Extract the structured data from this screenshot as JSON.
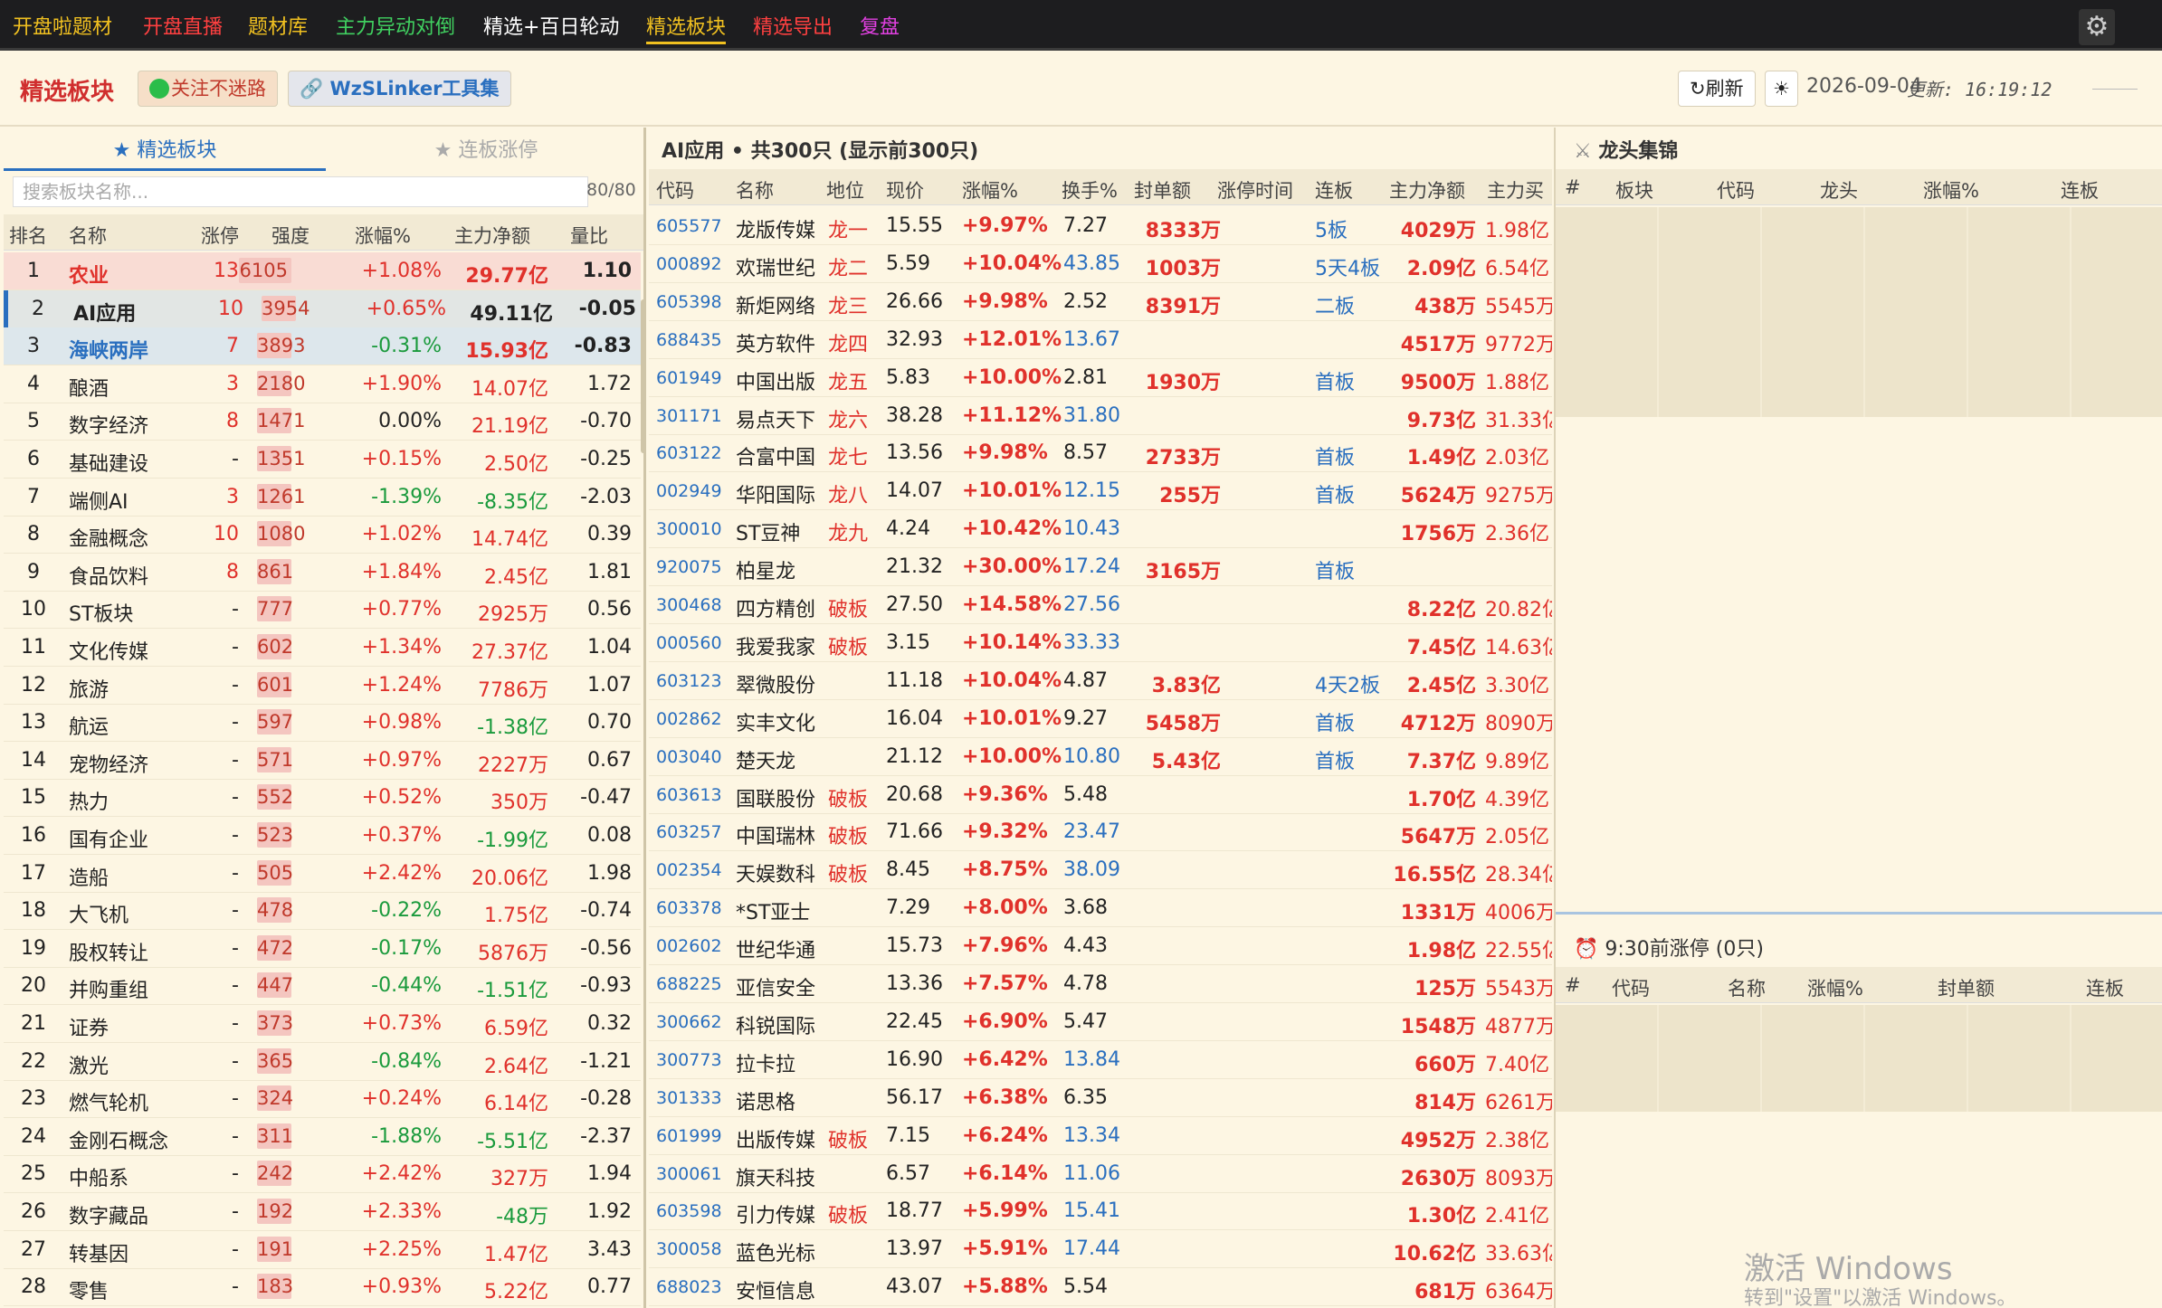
{
  "nav": {
    "items": [
      {
        "label": "开盘啦题材",
        "color": "#f0c020"
      },
      {
        "label": "开盘直播",
        "color": "#ff4040"
      },
      {
        "label": "题材库",
        "color": "#f0c020"
      },
      {
        "label": "主力异动对倒",
        "color": "#40d060"
      },
      {
        "label": "精选+百日轮动",
        "color": "#ffffff"
      },
      {
        "label": "精选板块",
        "color": "#f0c020"
      },
      {
        "label": "精选导出",
        "color": "#ff4040"
      },
      {
        "label": "复盘",
        "color": "#e040e0"
      }
    ],
    "settings_icon": "gear-icon"
  },
  "header": {
    "title": "精选板块",
    "follow_label": "关注不迷路",
    "tool_label": "WzSLinker工具集",
    "refresh_label": "刷新",
    "theme_icon": "sun-icon",
    "date": "2026-09-04",
    "update_text": "更新: 16:19:12"
  },
  "left": {
    "tabs": [
      "★ 精选板块",
      "★ 连板涨停"
    ],
    "search_placeholder": "搜索板块名称...",
    "count": "80/80",
    "columns": [
      "排名",
      "名称",
      "涨停",
      "强度",
      "涨幅%",
      "主力净额",
      "量比"
    ],
    "rows": [
      {
        "rank": "1",
        "name": "农业",
        "zt": "13",
        "strength": "6105",
        "strength_level": 1.0,
        "chg": "+1.08%",
        "net": "29.77亿",
        "vr": "1.10"
      },
      {
        "rank": "2",
        "name": "AI应用",
        "zt": "10",
        "strength": "3954",
        "strength_level": 0.65,
        "chg": "+0.65%",
        "net": "49.11亿",
        "vr": "-0.05"
      },
      {
        "rank": "3",
        "name": "海峡两岸",
        "zt": "7",
        "strength": "3893",
        "strength_level": 0.64,
        "chg": "-0.31%",
        "net": "15.93亿",
        "vr": "-0.83"
      },
      {
        "rank": "4",
        "name": "酿酒",
        "zt": "3",
        "strength": "2180",
        "strength_level": 0.36,
        "chg": "+1.90%",
        "net": "14.07亿",
        "vr": "1.72"
      },
      {
        "rank": "5",
        "name": "数字经济",
        "zt": "8",
        "strength": "1471",
        "strength_level": 0.24,
        "chg": "0.00%",
        "net": "21.19亿",
        "vr": "-0.70"
      },
      {
        "rank": "6",
        "name": "基础建设",
        "zt": "-",
        "strength": "1351",
        "strength_level": 0.22,
        "chg": "+0.15%",
        "net": "2.50亿",
        "vr": "-0.25"
      },
      {
        "rank": "7",
        "name": "端侧AI",
        "zt": "3",
        "strength": "1261",
        "strength_level": 0.21,
        "chg": "-1.39%",
        "net": "-8.35亿",
        "vr": "-2.03"
      },
      {
        "rank": "8",
        "name": "金融概念",
        "zt": "10",
        "strength": "1080",
        "strength_level": 0.18,
        "chg": "+1.02%",
        "net": "14.74亿",
        "vr": "0.39"
      },
      {
        "rank": "9",
        "name": "食品饮料",
        "zt": "8",
        "strength": "861",
        "strength_level": 0.14,
        "chg": "+1.84%",
        "net": "2.45亿",
        "vr": "1.81"
      },
      {
        "rank": "10",
        "name": "ST板块",
        "zt": "-",
        "strength": "777",
        "strength_level": 0.13,
        "chg": "+0.77%",
        "net": "2925万",
        "vr": "0.56"
      },
      {
        "rank": "11",
        "name": "文化传媒",
        "zt": "-",
        "strength": "602",
        "strength_level": 0.1,
        "chg": "+1.34%",
        "net": "27.37亿",
        "vr": "1.04"
      },
      {
        "rank": "12",
        "name": "旅游",
        "zt": "-",
        "strength": "601",
        "strength_level": 0.1,
        "chg": "+1.24%",
        "net": "7786万",
        "vr": "1.07"
      },
      {
        "rank": "13",
        "name": "航运",
        "zt": "-",
        "strength": "597",
        "strength_level": 0.1,
        "chg": "+0.98%",
        "net": "-1.38亿",
        "vr": "0.70"
      },
      {
        "rank": "14",
        "name": "宠物经济",
        "zt": "-",
        "strength": "571",
        "strength_level": 0.09,
        "chg": "+0.97%",
        "net": "2227万",
        "vr": "0.67"
      },
      {
        "rank": "15",
        "name": "热力",
        "zt": "-",
        "strength": "552",
        "strength_level": 0.09,
        "chg": "+0.52%",
        "net": "350万",
        "vr": "-0.47"
      },
      {
        "rank": "16",
        "name": "国有企业",
        "zt": "-",
        "strength": "523",
        "strength_level": 0.09,
        "chg": "+0.37%",
        "net": "-1.99亿",
        "vr": "0.08"
      },
      {
        "rank": "17",
        "name": "造船",
        "zt": "-",
        "strength": "505",
        "strength_level": 0.08,
        "chg": "+2.42%",
        "net": "20.06亿",
        "vr": "1.98"
      },
      {
        "rank": "18",
        "name": "大飞机",
        "zt": "-",
        "strength": "478",
        "strength_level": 0.08,
        "chg": "-0.22%",
        "net": "1.75亿",
        "vr": "-0.74"
      },
      {
        "rank": "19",
        "name": "股权转让",
        "zt": "-",
        "strength": "472",
        "strength_level": 0.08,
        "chg": "-0.17%",
        "net": "5876万",
        "vr": "-0.56"
      },
      {
        "rank": "20",
        "name": "并购重组",
        "zt": "-",
        "strength": "447",
        "strength_level": 0.07,
        "chg": "-0.44%",
        "net": "-1.51亿",
        "vr": "-0.93"
      },
      {
        "rank": "21",
        "name": "证券",
        "zt": "-",
        "strength": "373",
        "strength_level": 0.06,
        "chg": "+0.73%",
        "net": "6.59亿",
        "vr": "0.32"
      },
      {
        "rank": "22",
        "name": "激光",
        "zt": "-",
        "strength": "365",
        "strength_level": 0.06,
        "chg": "-0.84%",
        "net": "2.64亿",
        "vr": "-1.21"
      },
      {
        "rank": "23",
        "name": "燃气轮机",
        "zt": "-",
        "strength": "324",
        "strength_level": 0.05,
        "chg": "+0.24%",
        "net": "6.14亿",
        "vr": "-0.28"
      },
      {
        "rank": "24",
        "name": "金刚石概念",
        "zt": "-",
        "strength": "311",
        "strength_level": 0.05,
        "chg": "-1.88%",
        "net": "-5.51亿",
        "vr": "-2.37"
      },
      {
        "rank": "25",
        "name": "中船系",
        "zt": "-",
        "strength": "242",
        "strength_level": 0.04,
        "chg": "+2.42%",
        "net": "327万",
        "vr": "1.94"
      },
      {
        "rank": "26",
        "name": "数字藏品",
        "zt": "-",
        "strength": "192",
        "strength_level": 0.03,
        "chg": "+2.33%",
        "net": "-48万",
        "vr": "1.92"
      },
      {
        "rank": "27",
        "name": "转基因",
        "zt": "-",
        "strength": "191",
        "strength_level": 0.03,
        "chg": "+2.25%",
        "net": "1.47亿",
        "vr": "3.43"
      },
      {
        "rank": "28",
        "name": "零售",
        "zt": "-",
        "strength": "183",
        "strength_level": 0.03,
        "chg": "+0.93%",
        "net": "5.22亿",
        "vr": "0.77"
      }
    ]
  },
  "mid": {
    "title": "AI应用 • 共300只 (显示前300只)",
    "columns": [
      "代码",
      "名称",
      "地位",
      "现价",
      "涨幅%",
      "换手%",
      "封单额",
      "涨停时间",
      "连板",
      "主力净额",
      "主力买"
    ],
    "rows": [
      {
        "code": "605577",
        "name": "龙版传媒",
        "pos": "龙一",
        "price": "15.55",
        "chg": "+9.97%",
        "turn": "7.27",
        "seal": "8333万",
        "time": "",
        "lb": "5板",
        "net": "4029万",
        "buy": "1.98亿"
      },
      {
        "code": "000892",
        "name": "欢瑞世纪",
        "pos": "龙二",
        "price": "5.59",
        "chg": "+10.04%",
        "turn": "43.85",
        "seal": "1003万",
        "time": "",
        "lb": "5天4板",
        "net": "2.09亿",
        "buy": "6.54亿"
      },
      {
        "code": "605398",
        "name": "新炬网络",
        "pos": "龙三",
        "price": "26.66",
        "chg": "+9.98%",
        "turn": "2.52",
        "seal": "8391万",
        "time": "",
        "lb": "二板",
        "net": "438万",
        "buy": "5545万"
      },
      {
        "code": "688435",
        "name": "英方软件",
        "pos": "龙四",
        "price": "32.93",
        "chg": "+12.01%",
        "turn": "13.67",
        "seal": "",
        "time": "",
        "lb": "",
        "net": "4517万",
        "buy": "9772万"
      },
      {
        "code": "601949",
        "name": "中国出版",
        "pos": "龙五",
        "price": "5.83",
        "chg": "+10.00%",
        "turn": "2.81",
        "seal": "1930万",
        "time": "",
        "lb": "首板",
        "net": "9500万",
        "buy": "1.88亿"
      },
      {
        "code": "301171",
        "name": "易点天下",
        "pos": "龙六",
        "price": "38.28",
        "chg": "+11.12%",
        "turn": "31.80",
        "seal": "",
        "time": "",
        "lb": "",
        "net": "9.73亿",
        "buy": "31.33亿"
      },
      {
        "code": "603122",
        "name": "合富中国",
        "pos": "龙七",
        "price": "13.56",
        "chg": "+9.98%",
        "turn": "8.57",
        "seal": "2733万",
        "time": "",
        "lb": "首板",
        "net": "1.49亿",
        "buy": "2.03亿"
      },
      {
        "code": "002949",
        "name": "华阳国际",
        "pos": "龙八",
        "price": "14.07",
        "chg": "+10.01%",
        "turn": "12.15",
        "seal": "255万",
        "time": "",
        "lb": "首板",
        "net": "5624万",
        "buy": "9275万"
      },
      {
        "code": "300010",
        "name": "ST豆神",
        "pos": "龙九",
        "price": "4.24",
        "chg": "+10.42%",
        "turn": "10.43",
        "seal": "",
        "time": "",
        "lb": "",
        "net": "1756万",
        "buy": "2.36亿"
      },
      {
        "code": "920075",
        "name": "柏星龙",
        "pos": "",
        "price": "21.32",
        "chg": "+30.00%",
        "turn": "17.24",
        "seal": "3165万",
        "time": "",
        "lb": "首板",
        "net": "",
        "buy": ""
      },
      {
        "code": "300468",
        "name": "四方精创",
        "pos": "破板",
        "price": "27.50",
        "chg": "+14.58%",
        "turn": "27.56",
        "seal": "",
        "time": "",
        "lb": "",
        "net": "8.22亿",
        "buy": "20.82亿"
      },
      {
        "code": "000560",
        "name": "我爱我家",
        "pos": "破板",
        "price": "3.15",
        "chg": "+10.14%",
        "turn": "33.33",
        "seal": "",
        "time": "",
        "lb": "",
        "net": "7.45亿",
        "buy": "14.63亿"
      },
      {
        "code": "603123",
        "name": "翠微股份",
        "pos": "",
        "price": "11.18",
        "chg": "+10.04%",
        "turn": "4.87",
        "seal": "3.83亿",
        "time": "",
        "lb": "4天2板",
        "net": "2.45亿",
        "buy": "3.30亿"
      },
      {
        "code": "002862",
        "name": "实丰文化",
        "pos": "",
        "price": "16.04",
        "chg": "+10.01%",
        "turn": "9.27",
        "seal": "5458万",
        "time": "",
        "lb": "首板",
        "net": "4712万",
        "buy": "8090万"
      },
      {
        "code": "003040",
        "name": "楚天龙",
        "pos": "",
        "price": "21.12",
        "chg": "+10.00%",
        "turn": "10.80",
        "seal": "5.43亿",
        "time": "",
        "lb": "首板",
        "net": "7.37亿",
        "buy": "9.89亿"
      },
      {
        "code": "603613",
        "name": "国联股份",
        "pos": "破板",
        "price": "20.68",
        "chg": "+9.36%",
        "turn": "5.48",
        "seal": "",
        "time": "",
        "lb": "",
        "net": "1.70亿",
        "buy": "4.39亿"
      },
      {
        "code": "603257",
        "name": "中国瑞林",
        "pos": "破板",
        "price": "71.66",
        "chg": "+9.32%",
        "turn": "23.47",
        "seal": "",
        "time": "",
        "lb": "",
        "net": "5647万",
        "buy": "2.05亿"
      },
      {
        "code": "002354",
        "name": "天娱数科",
        "pos": "破板",
        "price": "8.45",
        "chg": "+8.75%",
        "turn": "38.09",
        "seal": "",
        "time": "",
        "lb": "",
        "net": "16.55亿",
        "buy": "28.34亿"
      },
      {
        "code": "603378",
        "name": "*ST亚士",
        "pos": "",
        "price": "7.29",
        "chg": "+8.00%",
        "turn": "3.68",
        "seal": "",
        "time": "",
        "lb": "",
        "net": "1331万",
        "buy": "4006万"
      },
      {
        "code": "002602",
        "name": "世纪华通",
        "pos": "",
        "price": "15.73",
        "chg": "+7.96%",
        "turn": "4.43",
        "seal": "",
        "time": "",
        "lb": "",
        "net": "1.98亿",
        "buy": "22.55亿"
      },
      {
        "code": "688225",
        "name": "亚信安全",
        "pos": "",
        "price": "13.36",
        "chg": "+7.57%",
        "turn": "4.78",
        "seal": "",
        "time": "",
        "lb": "",
        "net": "125万",
        "buy": "5543万"
      },
      {
        "code": "300662",
        "name": "科锐国际",
        "pos": "",
        "price": "22.45",
        "chg": "+6.90%",
        "turn": "5.47",
        "seal": "",
        "time": "",
        "lb": "",
        "net": "1548万",
        "buy": "4877万"
      },
      {
        "code": "300773",
        "name": "拉卡拉",
        "pos": "",
        "price": "16.90",
        "chg": "+6.42%",
        "turn": "13.84",
        "seal": "",
        "time": "",
        "lb": "",
        "net": "660万",
        "buy": "7.40亿"
      },
      {
        "code": "301333",
        "name": "诺思格",
        "pos": "",
        "price": "56.17",
        "chg": "+6.38%",
        "turn": "6.35",
        "seal": "",
        "time": "",
        "lb": "",
        "net": "814万",
        "buy": "6261万"
      },
      {
        "code": "601999",
        "name": "出版传媒",
        "pos": "破板",
        "price": "7.15",
        "chg": "+6.24%",
        "turn": "13.34",
        "seal": "",
        "time": "",
        "lb": "",
        "net": "4952万",
        "buy": "2.38亿"
      },
      {
        "code": "300061",
        "name": "旗天科技",
        "pos": "",
        "price": "6.57",
        "chg": "+6.14%",
        "turn": "11.06",
        "seal": "",
        "time": "",
        "lb": "",
        "net": "2630万",
        "buy": "8093万"
      },
      {
        "code": "603598",
        "name": "引力传媒",
        "pos": "破板",
        "price": "18.77",
        "chg": "+5.99%",
        "turn": "15.41",
        "seal": "",
        "time": "",
        "lb": "",
        "net": "1.30亿",
        "buy": "2.41亿"
      },
      {
        "code": "300058",
        "name": "蓝色光标",
        "pos": "",
        "price": "13.97",
        "chg": "+5.91%",
        "turn": "17.44",
        "seal": "",
        "time": "",
        "lb": "",
        "net": "10.62亿",
        "buy": "33.63亿"
      },
      {
        "code": "688023",
        "name": "安恒信息",
        "pos": "",
        "price": "43.07",
        "chg": "+5.88%",
        "turn": "5.54",
        "seal": "",
        "time": "",
        "lb": "",
        "net": "681万",
        "buy": "6364万"
      }
    ]
  },
  "right": {
    "top_title": "龙头集锦",
    "top_icon": "crossed-swords-icon",
    "top_columns": [
      "#",
      "板块",
      "代码",
      "龙头",
      "涨幅%",
      "连板"
    ],
    "bottom_title": "9:30前涨停 (0只)",
    "bottom_icon": "alarm-clock-icon",
    "bottom_columns": [
      "#",
      "代码",
      "名称",
      "涨幅%",
      "封单额",
      "连板"
    ],
    "watermark_line1": "激活 Windows",
    "watermark_line2": "转到\"设置\"以激活 Windows。"
  },
  "colors": {
    "accent": "#d02e2e",
    "up": "#e0312b",
    "down": "#1a9a3c",
    "link": "#2a6fbf",
    "strength": "#f4c6c0"
  }
}
